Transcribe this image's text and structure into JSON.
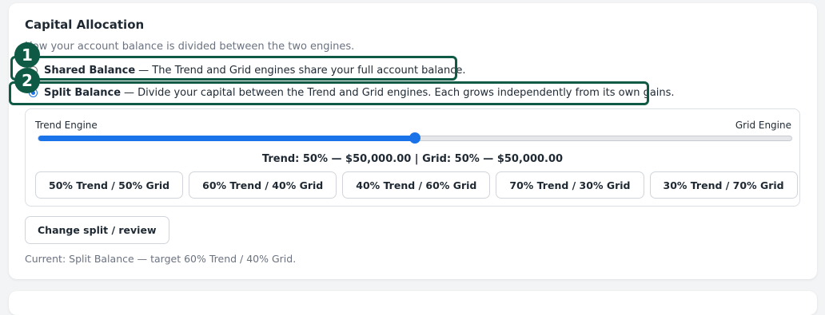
{
  "section": {
    "title": "Capital Allocation",
    "subtitle": "How your account balance is divided between the two engines."
  },
  "options": [
    {
      "name": "Shared Balance",
      "description": "— The Trend and Grid engines share your full account balance.",
      "selected": false,
      "annotation": "1"
    },
    {
      "name": "Split Balance",
      "description": "— Divide your capital between the Trend and Grid engines. Each grows independently from its own gains.",
      "selected": true,
      "annotation": "2"
    }
  ],
  "slider": {
    "left_label": "Trend Engine",
    "right_label": "Grid Engine",
    "value_percent": 50
  },
  "summary": "Trend: 50% — $50,000.00 | Grid: 50% — $50,000.00",
  "presets": [
    "50% Trend / 50% Grid",
    "60% Trend / 40% Grid",
    "40% Trend / 60% Grid",
    "70% Trend / 30% Grid",
    "30% Trend / 70% Grid"
  ],
  "change_button": "Change split / review",
  "current_status": "Current: Split Balance — target 60% Trend / 40% Grid.",
  "colors": {
    "accent": "#1a73e8",
    "annotation": "#0e5a44"
  }
}
